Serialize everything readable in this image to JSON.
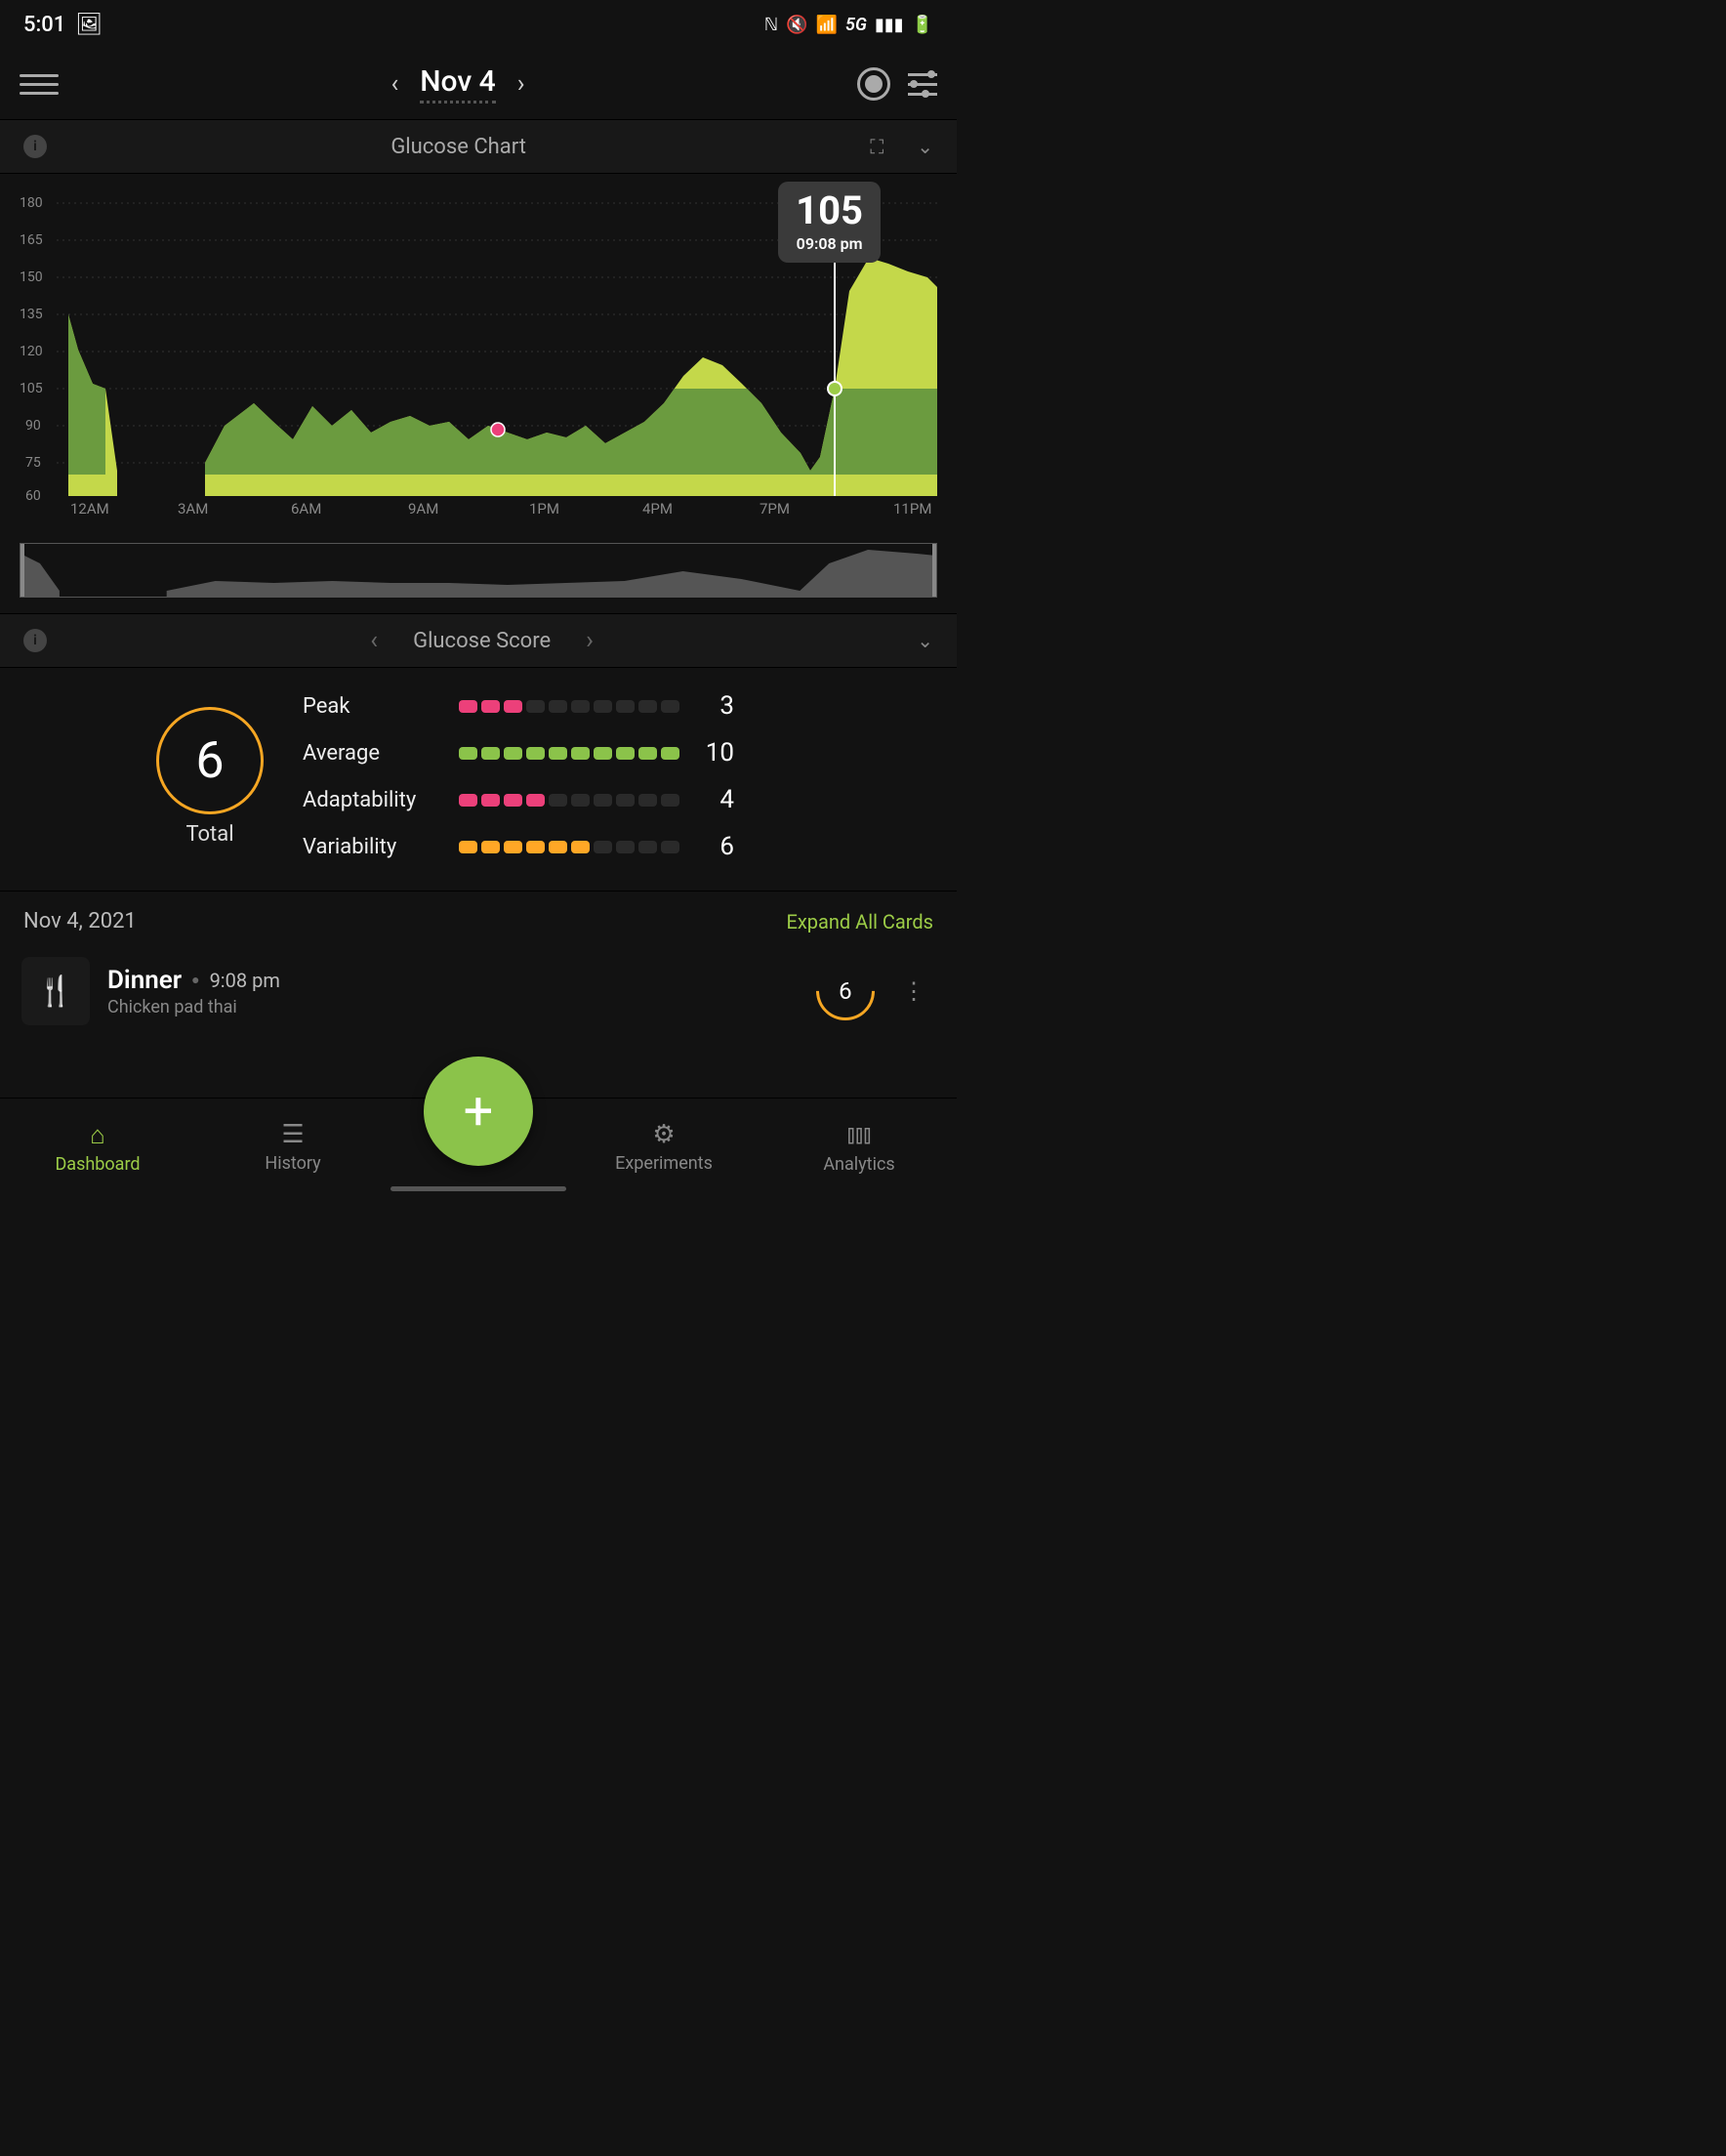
{
  "status": {
    "time": "5:01",
    "signal": "5G"
  },
  "header": {
    "date_label": "Nov 4"
  },
  "glucose_chart": {
    "title": "Glucose Chart",
    "tooltip": {
      "value": "105",
      "time": "09:08 pm"
    }
  },
  "glucose_score": {
    "title": "Glucose Score",
    "total_value": "6",
    "total_label": "Total",
    "metrics": {
      "peak": {
        "label": "Peak",
        "value": "3",
        "filled": 3,
        "style": "pink"
      },
      "average": {
        "label": "Average",
        "value": "10",
        "filled": 10,
        "style": "green"
      },
      "adaptability": {
        "label": "Adaptability",
        "value": "4",
        "filled": 4,
        "style": "pink"
      },
      "variability": {
        "label": "Variability",
        "value": "6",
        "filled": 6,
        "style": "orange"
      }
    }
  },
  "cards": {
    "date": "Nov 4, 2021",
    "expand_label": "Expand All Cards",
    "dinner": {
      "title": "Dinner",
      "time": "9:08 pm",
      "subtitle": "Chicken pad thai",
      "score": "6"
    }
  },
  "nav": {
    "dashboard": "Dashboard",
    "history": "History",
    "experiments": "Experiments",
    "analytics": "Analytics"
  },
  "chart_data": {
    "type": "area",
    "title": "Glucose Chart",
    "xlabel": "",
    "ylabel": "",
    "ylim": [
      60,
      180
    ],
    "y_ticks": [
      60,
      75,
      90,
      105,
      120,
      135,
      150,
      165,
      180
    ],
    "x_ticks": [
      "12AM",
      "3AM",
      "6AM",
      "9AM",
      "1PM",
      "4PM",
      "7PM",
      "11PM"
    ],
    "target_band": [
      70,
      140
    ],
    "inner_band_top": 105,
    "series": [
      {
        "name": "glucose-early",
        "x_hours": [
          0,
          0.3,
          0.7,
          1.0,
          1.3
        ],
        "values": [
          135,
          122,
          108,
          105,
          72
        ]
      },
      {
        "name": "glucose-main",
        "x_hours": [
          4,
          4.5,
          5,
          5.5,
          6,
          6.5,
          7,
          7.5,
          8,
          8.5,
          9,
          9.5,
          10,
          10.5,
          11,
          11.5,
          12,
          12.5,
          13,
          13.5,
          14,
          14.5,
          15,
          15.5,
          16,
          16.5,
          17,
          17.5,
          18,
          18.5,
          19,
          19.5,
          20,
          20.5,
          21,
          21.5,
          22,
          22.5,
          23,
          23.5
        ],
        "values": [
          75,
          90,
          100,
          92,
          85,
          98,
          90,
          96,
          88,
          92,
          94,
          90,
          92,
          85,
          90,
          88,
          85,
          88,
          86,
          90,
          84,
          88,
          92,
          100,
          110,
          118,
          115,
          108,
          100,
          88,
          80,
          72,
          78,
          100,
          148,
          160,
          158,
          155,
          152,
          148
        ]
      }
    ],
    "marker": {
      "x_hours": 11,
      "value": 88,
      "color": "#ec407a"
    },
    "cursor": {
      "x_hours": 21.13,
      "value": 105,
      "label": "09:08 pm"
    }
  }
}
